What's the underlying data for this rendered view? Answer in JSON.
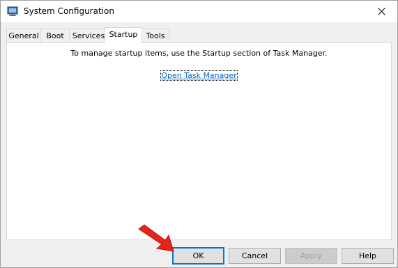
{
  "window": {
    "title": "System Configuration"
  },
  "icons": {
    "app": "system-configuration-icon",
    "close": "close-icon",
    "pointer": "red-arrow-icon"
  },
  "tabs": [
    {
      "label": "General",
      "active": false
    },
    {
      "label": "Boot",
      "active": false
    },
    {
      "label": "Services",
      "active": false
    },
    {
      "label": "Startup",
      "active": true
    },
    {
      "label": "Tools",
      "active": false
    }
  ],
  "startup": {
    "message": "To manage startup items, use the Startup section of Task Manager.",
    "link_label": "Open Task Manager"
  },
  "buttons": {
    "ok": "OK",
    "cancel": "Cancel",
    "apply": "Apply",
    "help": "Help"
  },
  "colors": {
    "link": "#0066cc",
    "default_button_border": "#0078d7",
    "annotation_arrow": "#e8231b"
  }
}
